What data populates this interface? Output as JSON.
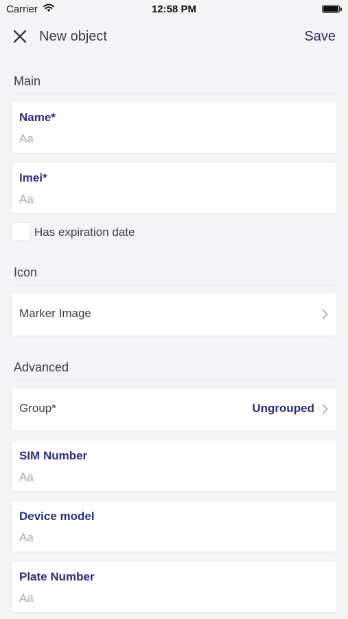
{
  "status_bar": {
    "carrier": "Carrier",
    "time": "12:58 PM",
    "battery_level": 1.0
  },
  "nav": {
    "title": "New object",
    "save_label": "Save"
  },
  "sections": {
    "main": {
      "title": "Main"
    },
    "icon": {
      "title": "Icon"
    },
    "advanced": {
      "title": "Advanced"
    }
  },
  "fields": {
    "name": {
      "label": "Name*",
      "placeholder": "Aa",
      "value": ""
    },
    "imei": {
      "label": "Imei*",
      "placeholder": "Aa",
      "value": ""
    },
    "sim_number": {
      "label": "SIM Number",
      "placeholder": "Aa",
      "value": ""
    },
    "device_model": {
      "label": "Device model",
      "placeholder": "Aa",
      "value": ""
    },
    "plate_number": {
      "label": "Plate Number",
      "placeholder": "Aa",
      "value": ""
    }
  },
  "expiration": {
    "label": "Has expiration date",
    "checked": false
  },
  "marker_image": {
    "label": "Marker Image"
  },
  "group": {
    "label": "Group*",
    "value": "Ungrouped"
  },
  "icons": [
    "close-icon",
    "wifi-icon",
    "battery-icon",
    "chevron-right-icon"
  ],
  "colors": {
    "accent": "#2a2e7a",
    "background": "#f4f4f6",
    "placeholder": "#a8a8b0"
  }
}
